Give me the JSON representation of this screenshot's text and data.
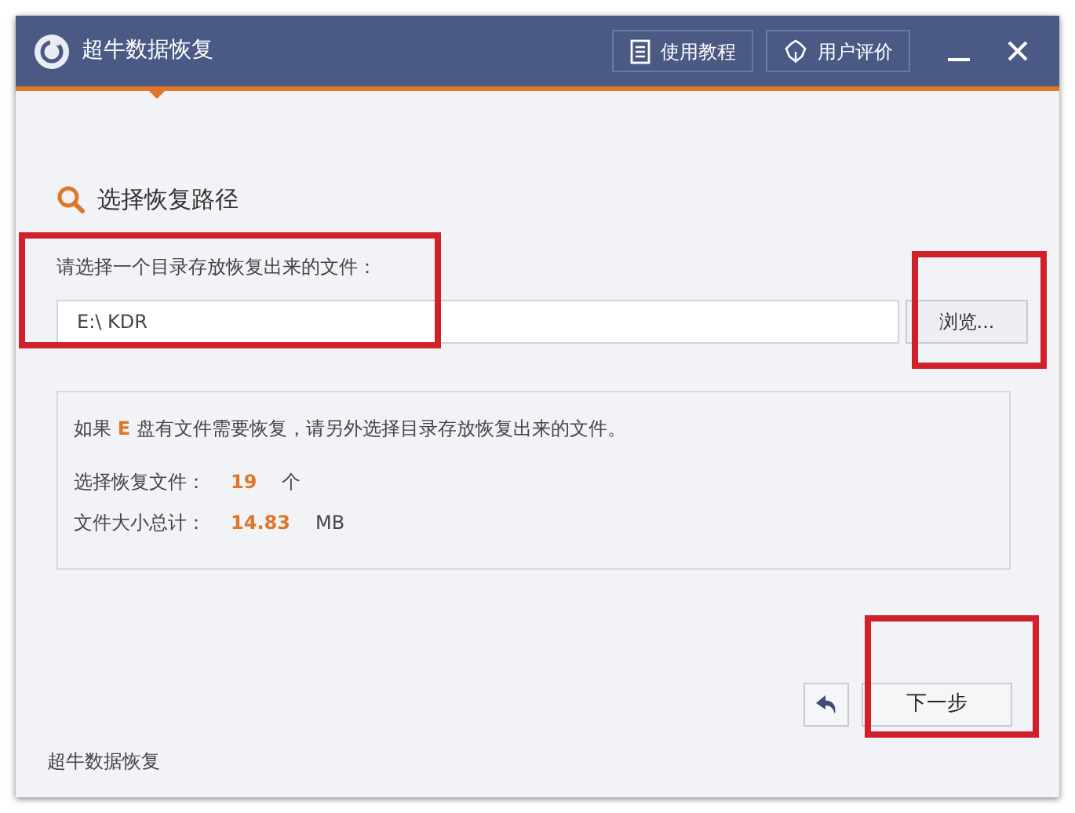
{
  "window": {
    "title": "超牛数据恢复"
  },
  "header_buttons": [
    {
      "kind": "guide",
      "label": "使用教程"
    },
    {
      "kind": "review",
      "label": "用户评价"
    }
  ],
  "section_title": "选择恢复路径",
  "path_label": "请选择一个目录存放恢复出来的文件：",
  "path_field": {
    "value": "E:\\ KDR"
  },
  "browse_button": "浏览...",
  "info": {
    "notice": "如果 **E** 盘有文件需要恢复，请另外选择目录存放恢复出来的文件。",
    "rows": [
      {
        "label": "选择恢复文件：",
        "value": "19",
        "unit": "个"
      },
      {
        "label": "文件大小总计：",
        "value": "14.83",
        "unit": "MB"
      }
    ]
  },
  "next_button": "下一步",
  "footer": "超牛数据恢复",
  "annotations": [
    {
      "kind": "frame"
    },
    {
      "kind": "frame"
    },
    {
      "kind": "frame"
    }
  ]
}
